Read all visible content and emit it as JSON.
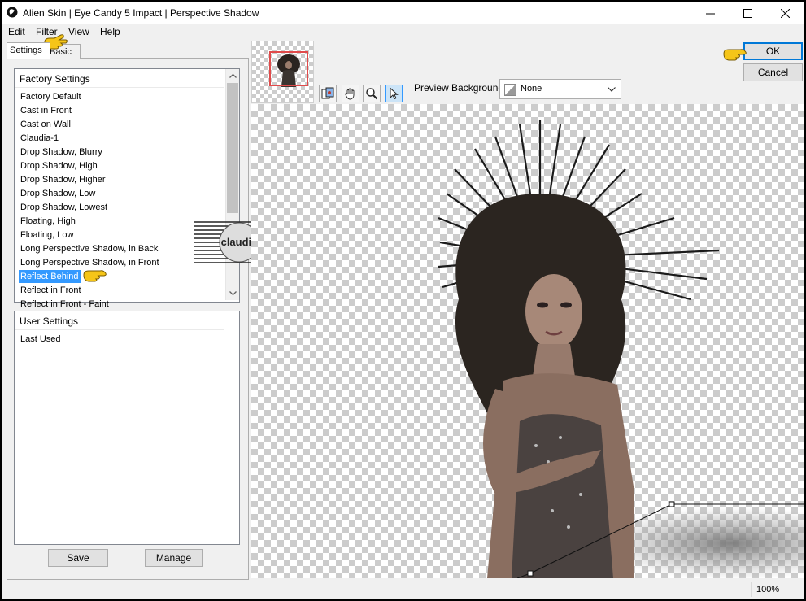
{
  "window": {
    "title": "Alien Skin | Eye Candy 5 Impact | Perspective Shadow"
  },
  "menu": {
    "edit": "Edit",
    "filter": "Filter",
    "view": "View",
    "help": "Help"
  },
  "tabs": {
    "settings": "Settings",
    "basic": "Basic"
  },
  "factory_settings": {
    "header": "Factory Settings",
    "items": [
      "Factory Default",
      "Cast in Front",
      "Cast on Wall",
      "Claudia-1",
      "Drop Shadow, Blurry",
      "Drop Shadow, High",
      "Drop Shadow, Higher",
      "Drop Shadow, Low",
      "Drop Shadow, Lowest",
      "Floating, High",
      "Floating, Low",
      "Long Perspective Shadow, in Back",
      "Long Perspective Shadow, in Front",
      "Reflect Behind",
      "Reflect in Front",
      "Reflect in Front - Faint"
    ],
    "selected": "Reflect Behind"
  },
  "user_settings": {
    "header": "User Settings",
    "items": [
      "Last Used"
    ]
  },
  "buttons": {
    "save": "Save",
    "manage": "Manage",
    "ok": "OK",
    "cancel": "Cancel"
  },
  "preview": {
    "background_label": "Preview Background:",
    "background_value": "None"
  },
  "watermark": {
    "text": "claudia"
  },
  "status": {
    "zoom": "100%"
  },
  "colors": {
    "selection": "#3399ff",
    "ok_border": "#0078d7",
    "pointer_hand": "#f5c518"
  },
  "icons": {
    "app": "alien-skin-icon",
    "minimize": "minimize-icon",
    "maximize": "maximize-icon",
    "close": "close-icon",
    "tool_zoom_preview": "preview-compare-icon",
    "tool_hand": "hand-pan-icon",
    "tool_zoom": "magnifier-icon",
    "tool_pointer": "arrow-pointer-icon",
    "dropdown": "chevron-down-icon",
    "pointer_hand": "pointing-hand-icon"
  }
}
